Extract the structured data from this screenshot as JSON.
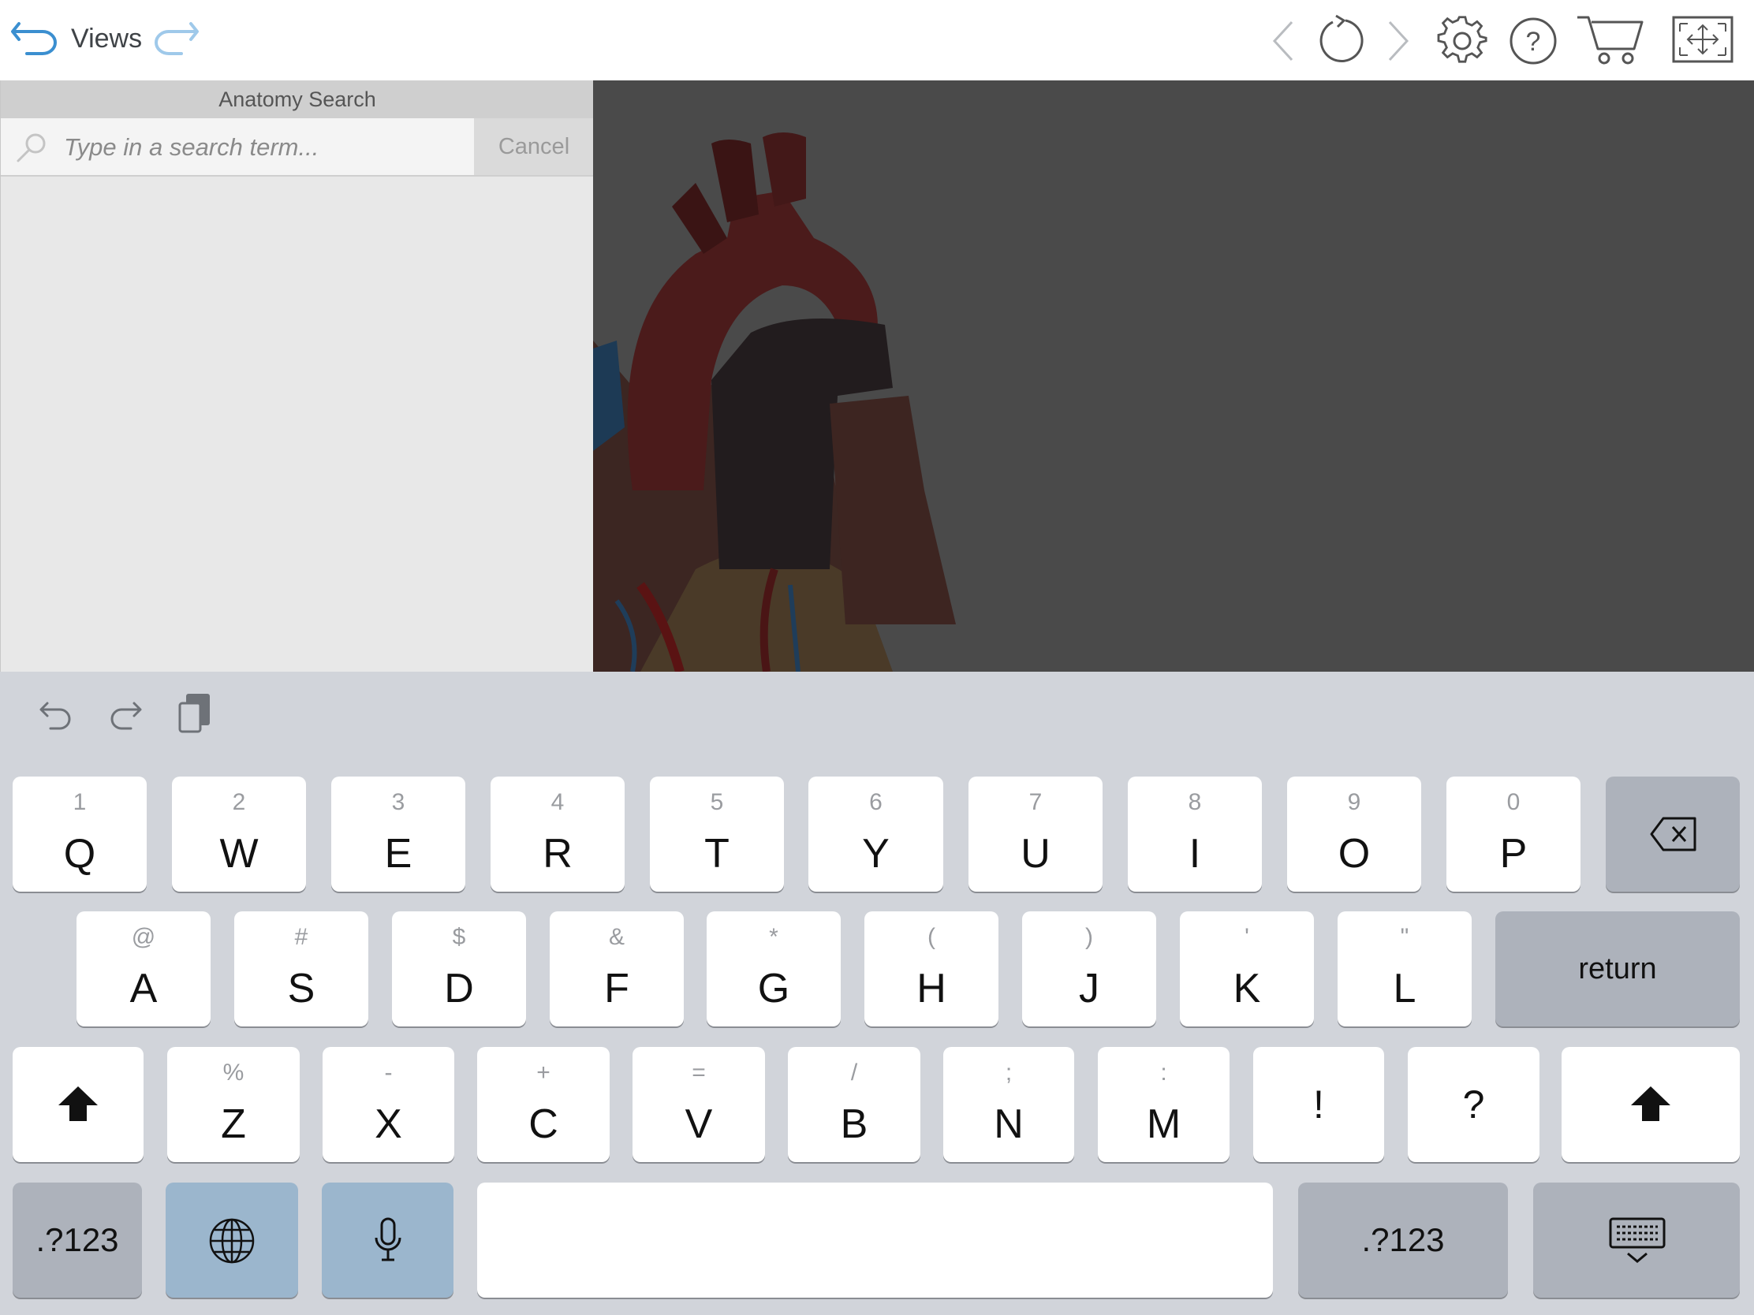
{
  "toolbar": {
    "views_label": "Views",
    "icons": [
      "undo-arrow-icon",
      "redo-arrow-icon",
      "prev-chevron-icon",
      "reset-rotate-icon",
      "next-chevron-icon",
      "gear-icon",
      "help-icon",
      "cart-icon",
      "fullscreen-icon"
    ]
  },
  "search": {
    "title": "Anatomy Search",
    "placeholder": "Type in a search term...",
    "value": "",
    "cancel_label": "Cancel"
  },
  "keyboard": {
    "row1": [
      {
        "main": "Q",
        "sub": "1"
      },
      {
        "main": "W",
        "sub": "2"
      },
      {
        "main": "E",
        "sub": "3"
      },
      {
        "main": "R",
        "sub": "4"
      },
      {
        "main": "T",
        "sub": "5"
      },
      {
        "main": "Y",
        "sub": "6"
      },
      {
        "main": "U",
        "sub": "7"
      },
      {
        "main": "I",
        "sub": "8"
      },
      {
        "main": "O",
        "sub": "9"
      },
      {
        "main": "P",
        "sub": "0"
      }
    ],
    "row2": [
      {
        "main": "A",
        "sub": "@"
      },
      {
        "main": "S",
        "sub": "#"
      },
      {
        "main": "D",
        "sub": "$"
      },
      {
        "main": "F",
        "sub": "&"
      },
      {
        "main": "G",
        "sub": "*"
      },
      {
        "main": "H",
        "sub": "("
      },
      {
        "main": "J",
        "sub": ")"
      },
      {
        "main": "K",
        "sub": "'"
      },
      {
        "main": "L",
        "sub": "\""
      }
    ],
    "row3": [
      {
        "main": "Z",
        "sub": "%"
      },
      {
        "main": "X",
        "sub": "-"
      },
      {
        "main": "C",
        "sub": "+"
      },
      {
        "main": "V",
        "sub": "="
      },
      {
        "main": "B",
        "sub": "/"
      },
      {
        "main": "N",
        "sub": ";"
      },
      {
        "main": "M",
        "sub": ":"
      }
    ],
    "exclaim": "!",
    "question": "?",
    "return_label": "return",
    "numbers_label": ".?123"
  }
}
